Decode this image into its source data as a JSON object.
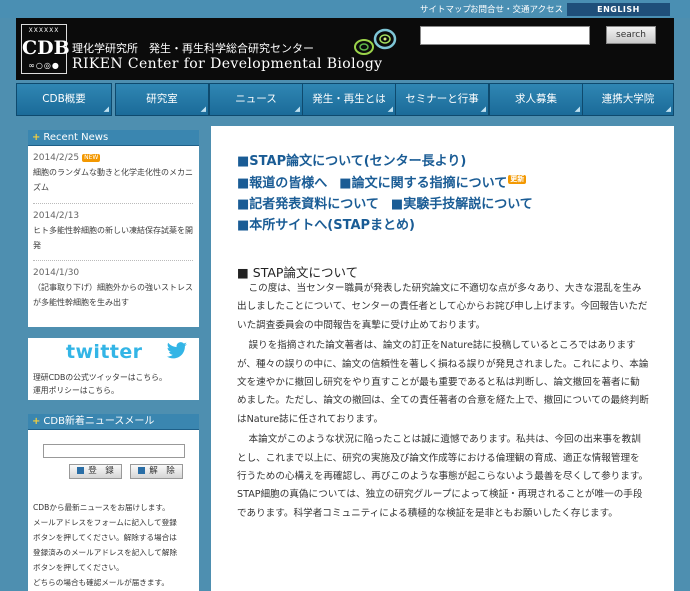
{
  "util": {
    "sitemap": "サイトマップ",
    "contact": "お問合せ・交通アクセス",
    "english": "ENGLISH"
  },
  "header": {
    "logo_text": "CDB",
    "title_jp": "理化学研究所　発生・再生科学総合研究センター",
    "title_en": "RIKEN  Center for Developmental Biology",
    "search_label": "search"
  },
  "nav": [
    {
      "label": "CDB概要"
    },
    {
      "label": "研究室"
    },
    {
      "label": "ニュース"
    },
    {
      "label": "発生・再生とは"
    },
    {
      "label": "セミナーと行事"
    },
    {
      "label": "求人募集"
    },
    {
      "label": "連携大学院"
    }
  ],
  "sidebar": {
    "recent_news_title": "Recent News",
    "news": [
      {
        "date": "2014/2/25",
        "new_badge": "NEW",
        "text": "細胞のランダムな動きと化学走化性のメカニズム"
      },
      {
        "date": "2014/2/13",
        "text": "ヒト多能性幹細胞の新しい凍結保存試薬を開発"
      },
      {
        "date": "2014/1/30",
        "text": "（記事取り下げ）細胞外からの強いストレスが多能性幹細胞を生み出す"
      }
    ],
    "twitter": {
      "logo": "twitter",
      "line1": "理研CDBの公式ツイッターはこちら。",
      "line2": "運用ポリシーはこちら。"
    },
    "mail": {
      "title": "CDB新着ニュースメール",
      "register": "登　録",
      "unregister": "解　除",
      "lines": [
        "CDBから最新ニュースをお届けします。",
        "メールアドレスをフォームに記入して登録",
        "ボタンを押してください。解除する場合は",
        "登録済みのメールアドレスを記入して解除",
        "ボタンを押してください。",
        "どちらの場合も確認メールが届きます。"
      ]
    }
  },
  "main": {
    "link1": "■STAP論文について(センター長より)",
    "link2": "■報道の皆様へ",
    "link3": "■論文に関する指摘について",
    "update_badge": "更新",
    "link4": "■記者発表資料について",
    "link5": "■実験手技解説について",
    "link6": "■本所サイトへ(STAPまとめ)",
    "section_title": "■ STAP論文について",
    "paragraphs": [
      "この度は、当センター職員が発表した研究論文に不適切な点が多々あり、大きな混乱を生み出しましたことについて、センターの責任者として心からお詫び申し上げます。今回報告いただいた調査委員会の中間報告を真摯に受け止めております。",
      "誤りを指摘された論文著者は、論文の訂正をNature誌に投稿しているところではありますが、種々の誤りの中に、論文の信頼性を著しく損ねる誤りが発見されました。これにより、本論文を速やかに撤回し研究をやり直すことが最も重要であると私は判断し、論文撤回を著者に勧めました。ただし、論文の撤回は、全ての責任著者の合意を経た上で、撤回についての最終判断はNature誌に任されております。",
      "本論文がこのような状況に陥ったことは誠に遺憾であります。私共は、今回の出来事を教訓とし、これまで以上に、研究の実施及び論文作成等における倫理観の育成、適正な情報管理を行うための心構えを再確認し、再びこのような事態が起こらないよう最善を尽くして参ります。STAP細胞の真偽については、独立の研究グループによって検証・再現されることが唯一の手段であります。科学者コミュニティによる積極的な検証を是非ともお願いしたく存じます。"
    ]
  }
}
